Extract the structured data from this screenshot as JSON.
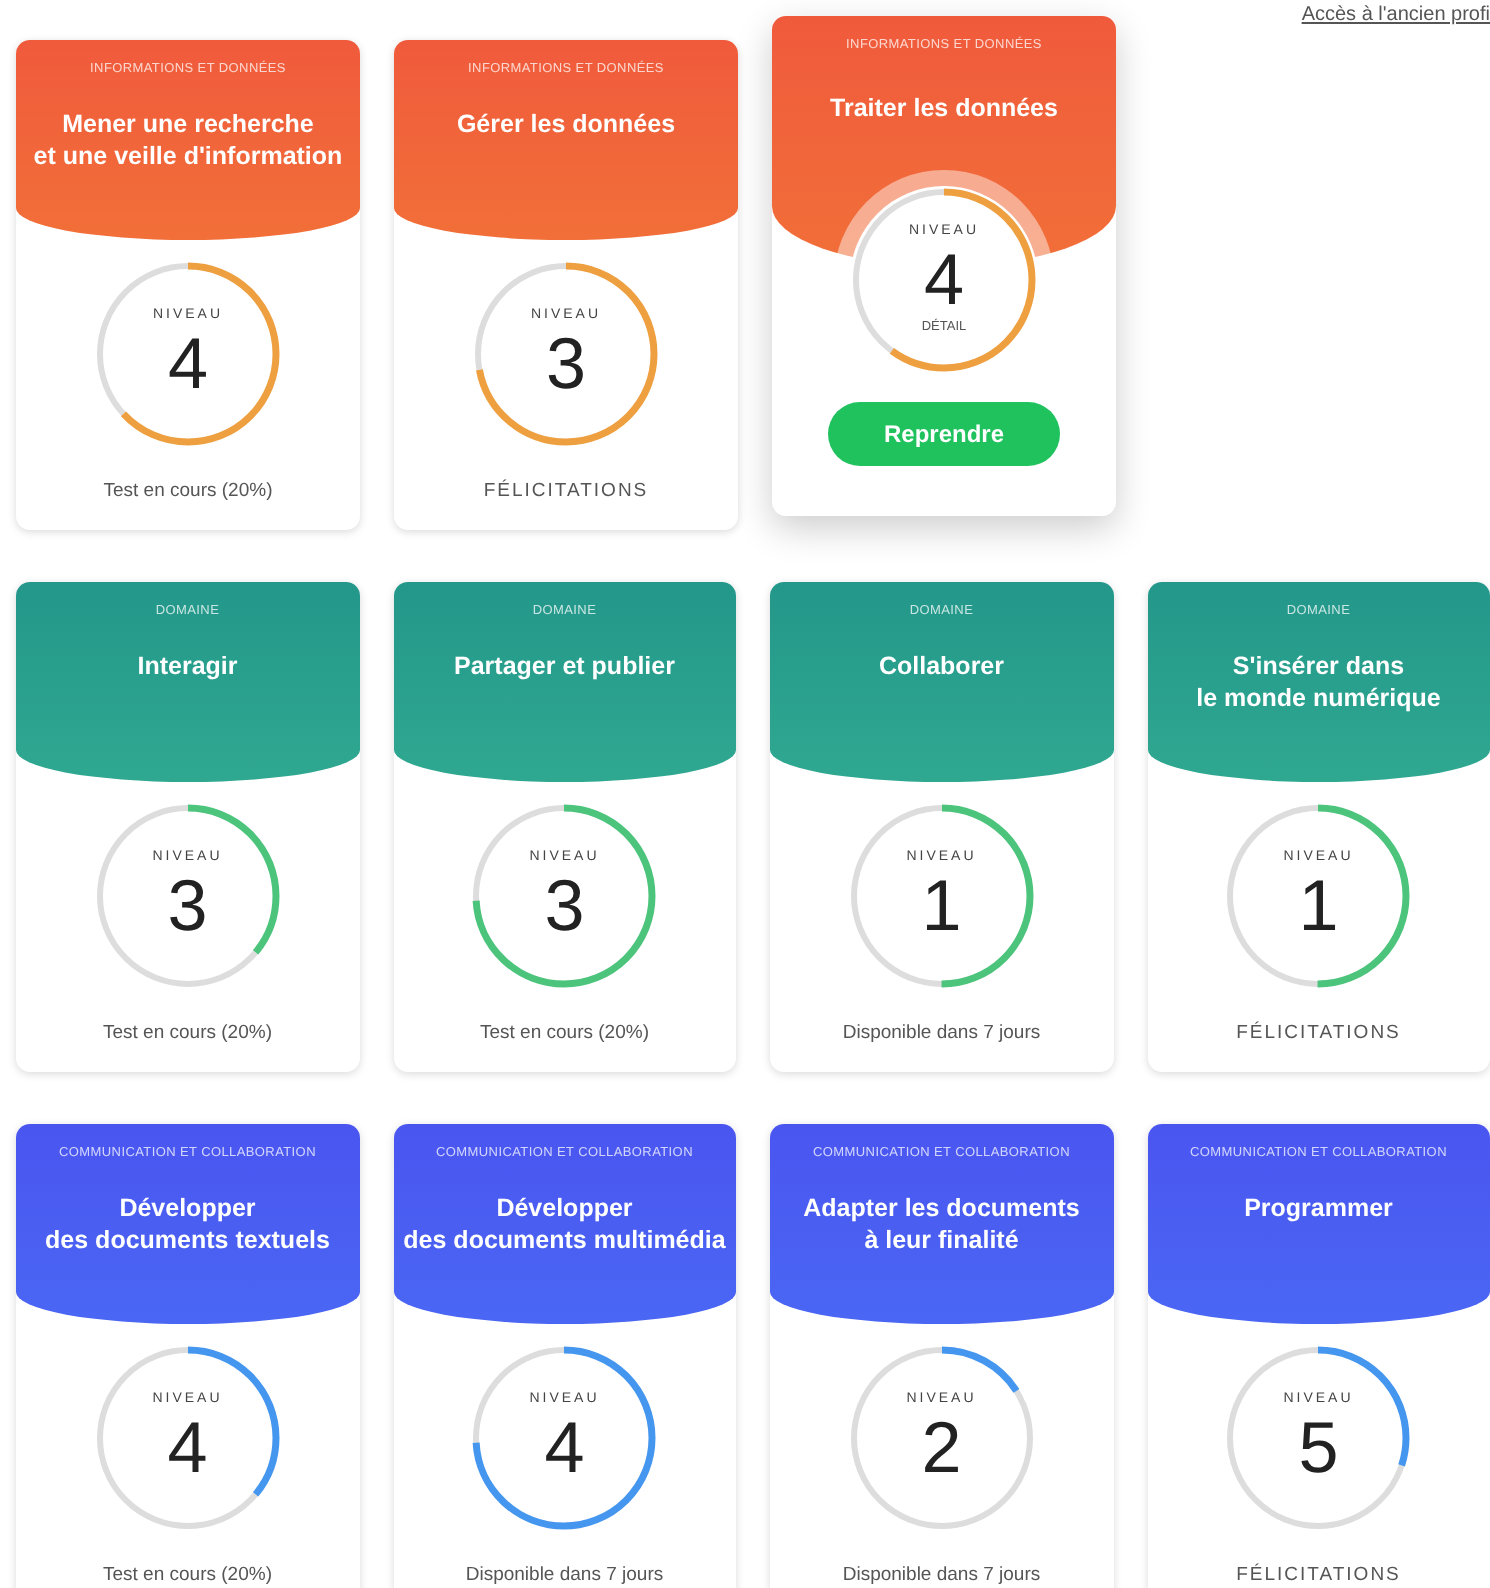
{
  "top_link": "Accès à l'ancien profi",
  "rows": [
    {
      "cards": [
        {
          "category": "INFORMATIONS ET DONNÉES",
          "title": "Mener une recherche\net une veille d'information",
          "level_label": "NIVEAU",
          "number": "4",
          "level": 0.63,
          "status": "Test en cours (20%)",
          "featured": false,
          "color": "#f05a3c"
        },
        {
          "category": "INFORMATIONS ET DONNÉES",
          "title": "Gérer les données",
          "level_label": "NIVEAU",
          "number": "3",
          "level": 0.72,
          "status": "FÉLICITATIONS",
          "featured": false,
          "color": "#f05a3c"
        },
        {
          "category": "INFORMATIONS ET DONNÉES",
          "title": "Traiter les données",
          "level_label": "NIVEAU",
          "number": "4",
          "level": 0.6,
          "detail": "DÉTAIL",
          "button": "Reprendre",
          "featured": true,
          "color": "#f05a3c"
        }
      ]
    },
    {
      "cards": [
        {
          "category": "DOMAINE",
          "title": "Interagir",
          "level_label": "NIVEAU",
          "number": "3",
          "level": 0.36,
          "status": "Test en cours (20%)",
          "featured": false,
          "color": "#23978a"
        },
        {
          "category": "DOMAINE",
          "title": "Partager et publier",
          "level_label": "NIVEAU",
          "number": "3",
          "level": 0.74,
          "status": "Test en cours (20%)",
          "featured": false,
          "color": "#23978a"
        },
        {
          "category": "DOMAINE",
          "title": "Collaborer",
          "level_label": "NIVEAU",
          "number": "1",
          "level": 0.5,
          "status": "Disponible dans 7 jours",
          "featured": false,
          "color": "#23978a"
        },
        {
          "category": "DOMAINE",
          "title": "S'insérer dans\nle monde numérique",
          "level_label": "NIVEAU",
          "number": "1",
          "level": 0.5,
          "status": "FÉLICITATIONS",
          "featured": false,
          "color": "#23978a"
        }
      ]
    },
    {
      "cards": [
        {
          "category": "COMMUNICATION ET COLLABORATION",
          "title": "Développer\ndes documents textuels",
          "level_label": "NIVEAU",
          "number": "4",
          "level": 0.36,
          "status": "Test en cours (20%)",
          "featured": false,
          "color": "#4a55f0"
        },
        {
          "category": "COMMUNICATION ET COLLABORATION",
          "title": "Développer\ndes documents multimédia",
          "level_label": "NIVEAU",
          "number": "4",
          "level": 0.74,
          "status": "Disponible dans 7 jours",
          "featured": false,
          "color": "#4a55f0"
        },
        {
          "category": "COMMUNICATION ET COLLABORATION",
          "title": "Adapter les documents\nà leur finalité",
          "level_label": "NIVEAU",
          "number": "2",
          "level": 0.16,
          "status": "Disponible dans 7 jours",
          "featured": false,
          "color": "#4a55f0"
        },
        {
          "category": "COMMUNICATION ET COLLABORATION",
          "title": "Programmer",
          "level_label": "NIVEAU",
          "number": "5",
          "level": 0.3,
          "status": "FÉLICITATIONS",
          "featured": false,
          "color": "#4a55f0"
        }
      ]
    }
  ]
}
